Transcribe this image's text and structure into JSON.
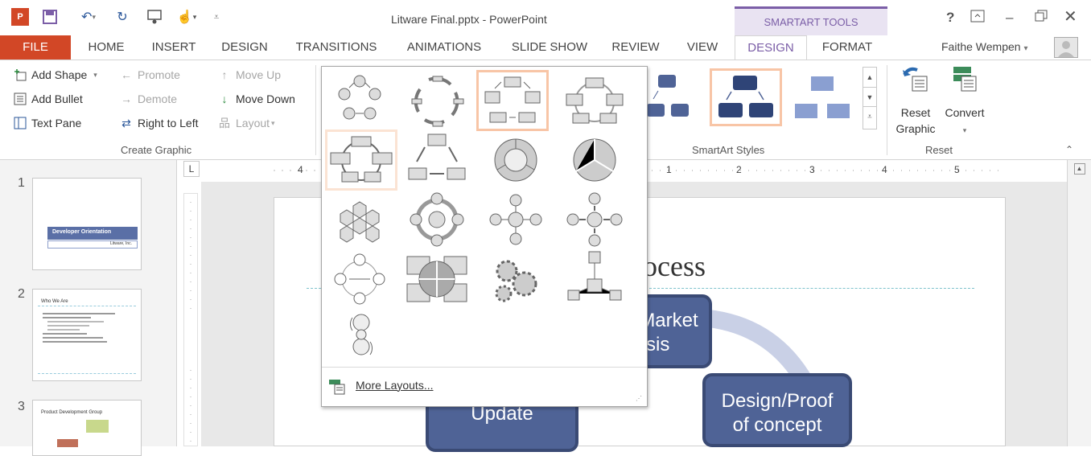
{
  "app": {
    "doc_title": "Litware Final.pptx - PowerPoint",
    "contextual_group": "SMARTART TOOLS",
    "help": "?",
    "user_name": "Faithe Wempen"
  },
  "tabs": [
    "FILE",
    "HOME",
    "INSERT",
    "DESIGN",
    "TRANSITIONS",
    "ANIMATIONS",
    "SLIDE SHOW",
    "REVIEW",
    "VIEW",
    "DESIGN",
    "FORMAT"
  ],
  "ribbon": {
    "create_graphic": {
      "add_shape": "Add Shape",
      "add_bullet": "Add Bullet",
      "text_pane": "Text Pane",
      "promote": "Promote",
      "demote": "Demote",
      "right_to_left": "Right to Left",
      "move_up": "Move Up",
      "move_down": "Move Down",
      "layout": "Layout",
      "label": "Create Graphic"
    },
    "styles_label": "SmartArt Styles",
    "reset": {
      "reset_graphic": "Reset Graphic",
      "reset_graphic_l1": "Reset",
      "reset_graphic_l2": "Graphic",
      "convert": "Convert",
      "label": "Reset"
    }
  },
  "gallery": {
    "items": [
      "basic-cycle",
      "text-cycle",
      "cycle",
      "continuous-cycle",
      "block-cycle",
      "segmented-cycle",
      "nondirectional-cycle",
      "multidirectional-cycle",
      "honeycomb",
      "circle-arrow-cycle",
      "radial-cycle",
      "diverging-radial",
      "basic-radial",
      "cycle-matrix",
      "gear",
      "radial-list",
      "hexagon-radial"
    ],
    "selected_index": 2,
    "hover_index": 4,
    "more_layouts": "More Layouts..."
  },
  "slides": [
    {
      "num": "1",
      "title": "Developer Orientation",
      "sub": "Litware, Inc."
    },
    {
      "num": "2",
      "title": "Who We Are"
    },
    {
      "num": "3",
      "title": "Product Development Group"
    }
  ],
  "ruler": {
    "ticks": [
      "4",
      "1",
      "2",
      "3",
      "4",
      "5"
    ]
  },
  "slide": {
    "title_fragment": "ocess",
    "boxes": {
      "market_l1": "Market",
      "market_l2": "sis",
      "update": "Update",
      "design_l1": "Design/Proof",
      "design_l2": "of concept"
    }
  },
  "colors": {
    "file_tab": "#d24726",
    "contextual_accent": "#7b5ea7",
    "smartart_fill": "#4f6396",
    "selection_border": "#f8c5a6"
  }
}
